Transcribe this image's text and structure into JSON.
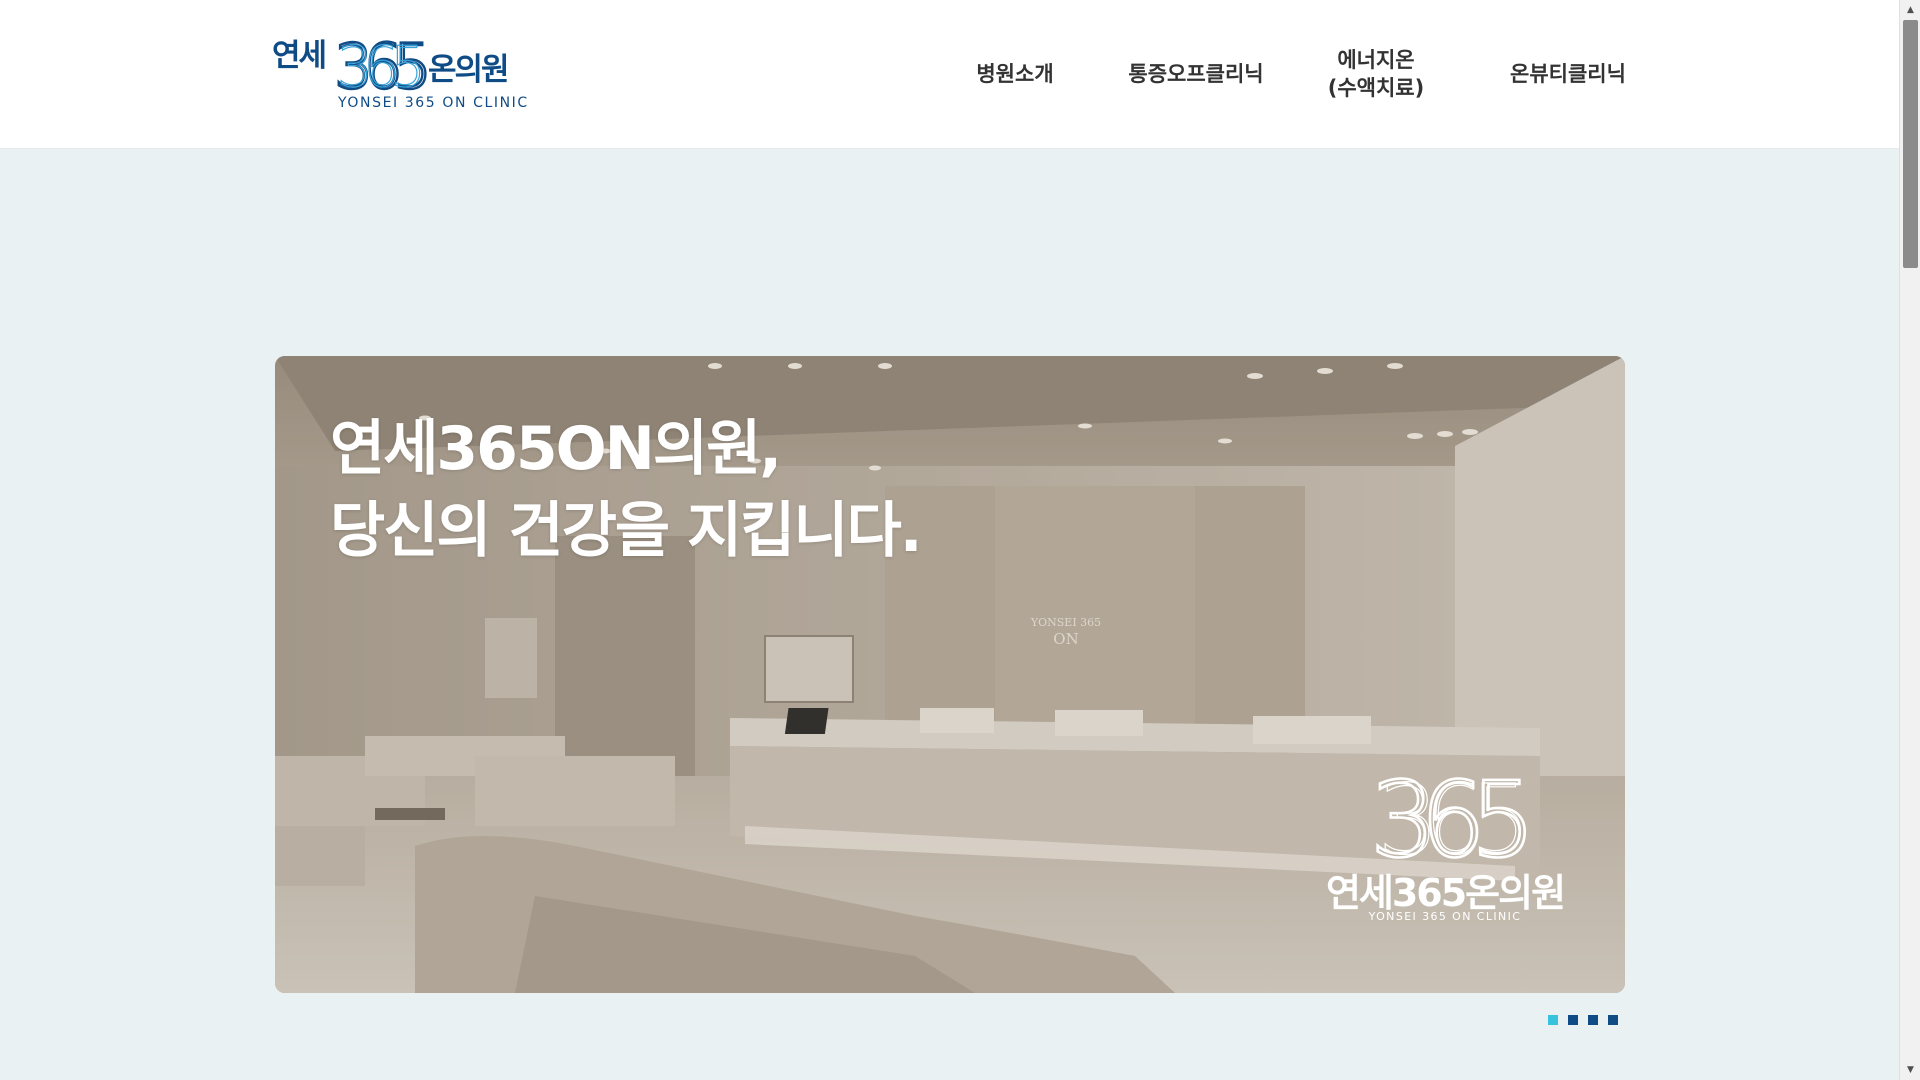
{
  "header": {
    "logo": {
      "ko_left": "연세",
      "numerals": "365",
      "ko_right": "온의원",
      "en": "YONSEI 365 ON CLINIC"
    },
    "nav": [
      {
        "label": "병원소개"
      },
      {
        "label": "통증오프클리닉"
      },
      {
        "label": "에너지온\n(수액치료)"
      },
      {
        "label": "온뷰티클리닉"
      }
    ]
  },
  "hero": {
    "headline_line1": "연세365ON의원,",
    "headline_line2": "당신의 건강을 지킵니다.",
    "wall_sign_line1": "YONSEI 365",
    "wall_sign_line2": "ON",
    "brand_numerals": "365",
    "brand_ko": "연세365온의원",
    "brand_en": "YONSEI 365 ON CLINIC"
  },
  "slider": {
    "total_slides": 4,
    "active_index": 0
  },
  "colors": {
    "brand_navy": "#0f4c86",
    "accent_cyan": "#38c3dc",
    "page_bg": "#e9f1f3"
  }
}
